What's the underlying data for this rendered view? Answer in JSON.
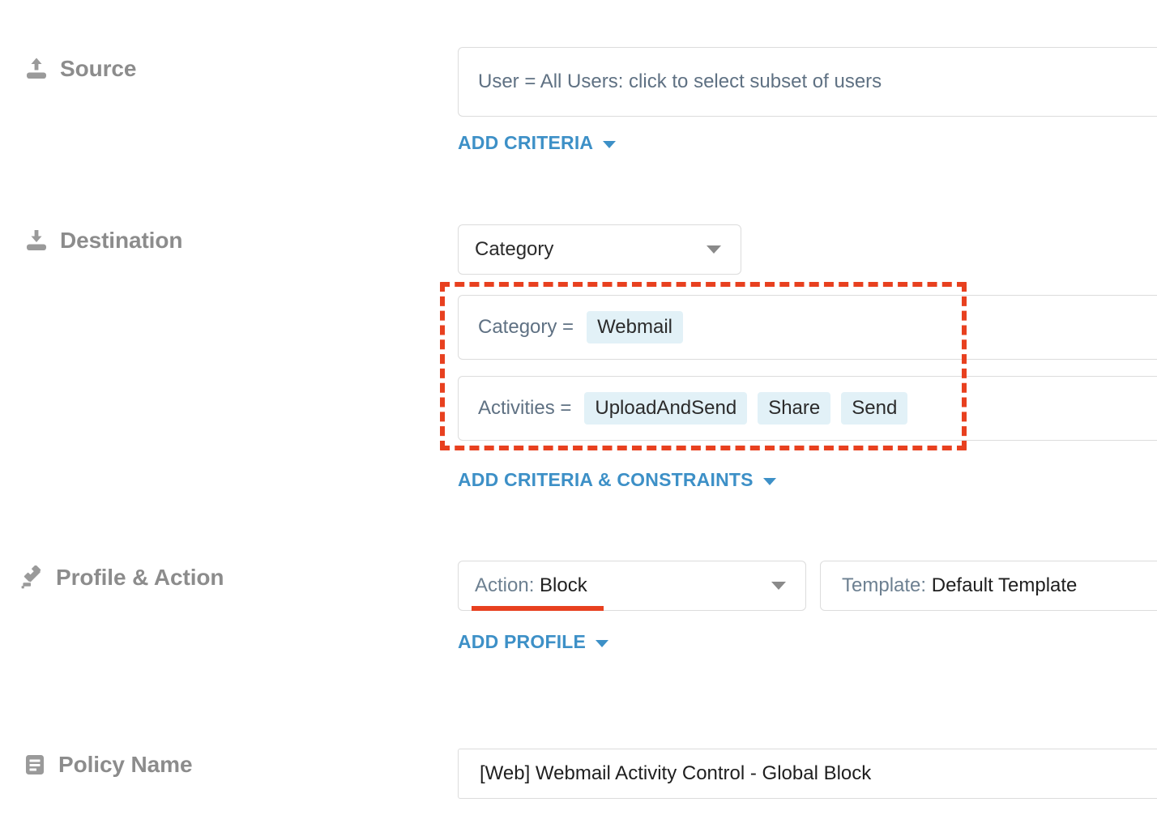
{
  "sections": [
    {
      "id": "source",
      "label": "Source",
      "icon": "upload-icon",
      "field_value": "User = All Users: click to select subset of users",
      "add_link": "ADD CRITERIA"
    },
    {
      "id": "destination",
      "label": "Destination",
      "icon": "download-icon",
      "select_value": "Category",
      "add_link": "ADD CRITERIA & CONSTRAINTS",
      "criteria": [
        {
          "key": "Category =",
          "chips": [
            "Webmail"
          ]
        },
        {
          "key": "Activities =",
          "chips": [
            "UploadAndSend",
            "Share",
            "Send"
          ]
        }
      ]
    },
    {
      "id": "profile_action",
      "label": "Profile & Action",
      "icon": "gavel-icon",
      "action_prefix": "Action:",
      "action_value": "Block",
      "template_prefix": "Template:",
      "template_value": "Default Template",
      "add_link": "ADD PROFILE"
    },
    {
      "id": "policy_name",
      "label": "Policy Name",
      "icon": "document-lines-icon",
      "field_value": "[Web] Webmail Activity Control - Global Block"
    }
  ],
  "source": {
    "label": "Source",
    "field_value": "User = All Users: click to select subset of users",
    "add_link": "ADD CRITERIA"
  },
  "destination": {
    "label": "Destination",
    "select_value": "Category",
    "criteria": [
      {
        "key": "Category =",
        "chips": [
          "Webmail"
        ]
      },
      {
        "key": "Activities =",
        "chips": [
          "UploadAndSend",
          "Share",
          "Send"
        ]
      }
    ],
    "add_link": "ADD CRITERIA & CONSTRAINTS"
  },
  "profile_action": {
    "label": "Profile & Action",
    "action_prefix": "Action:",
    "action_value": "Block",
    "template_prefix": "Template:",
    "template_value": "Default Template",
    "add_link": "ADD PROFILE"
  },
  "policy_name": {
    "label": "Policy Name",
    "field_value": "[Web] Webmail Activity Control - Global Block"
  },
  "colors": {
    "link_blue": "#3d90c7",
    "highlight_red": "#e8401f",
    "chip_blue": "#e2f1f7",
    "label_gray": "#8c8c8c",
    "border_gray": "#dcdcdc"
  }
}
